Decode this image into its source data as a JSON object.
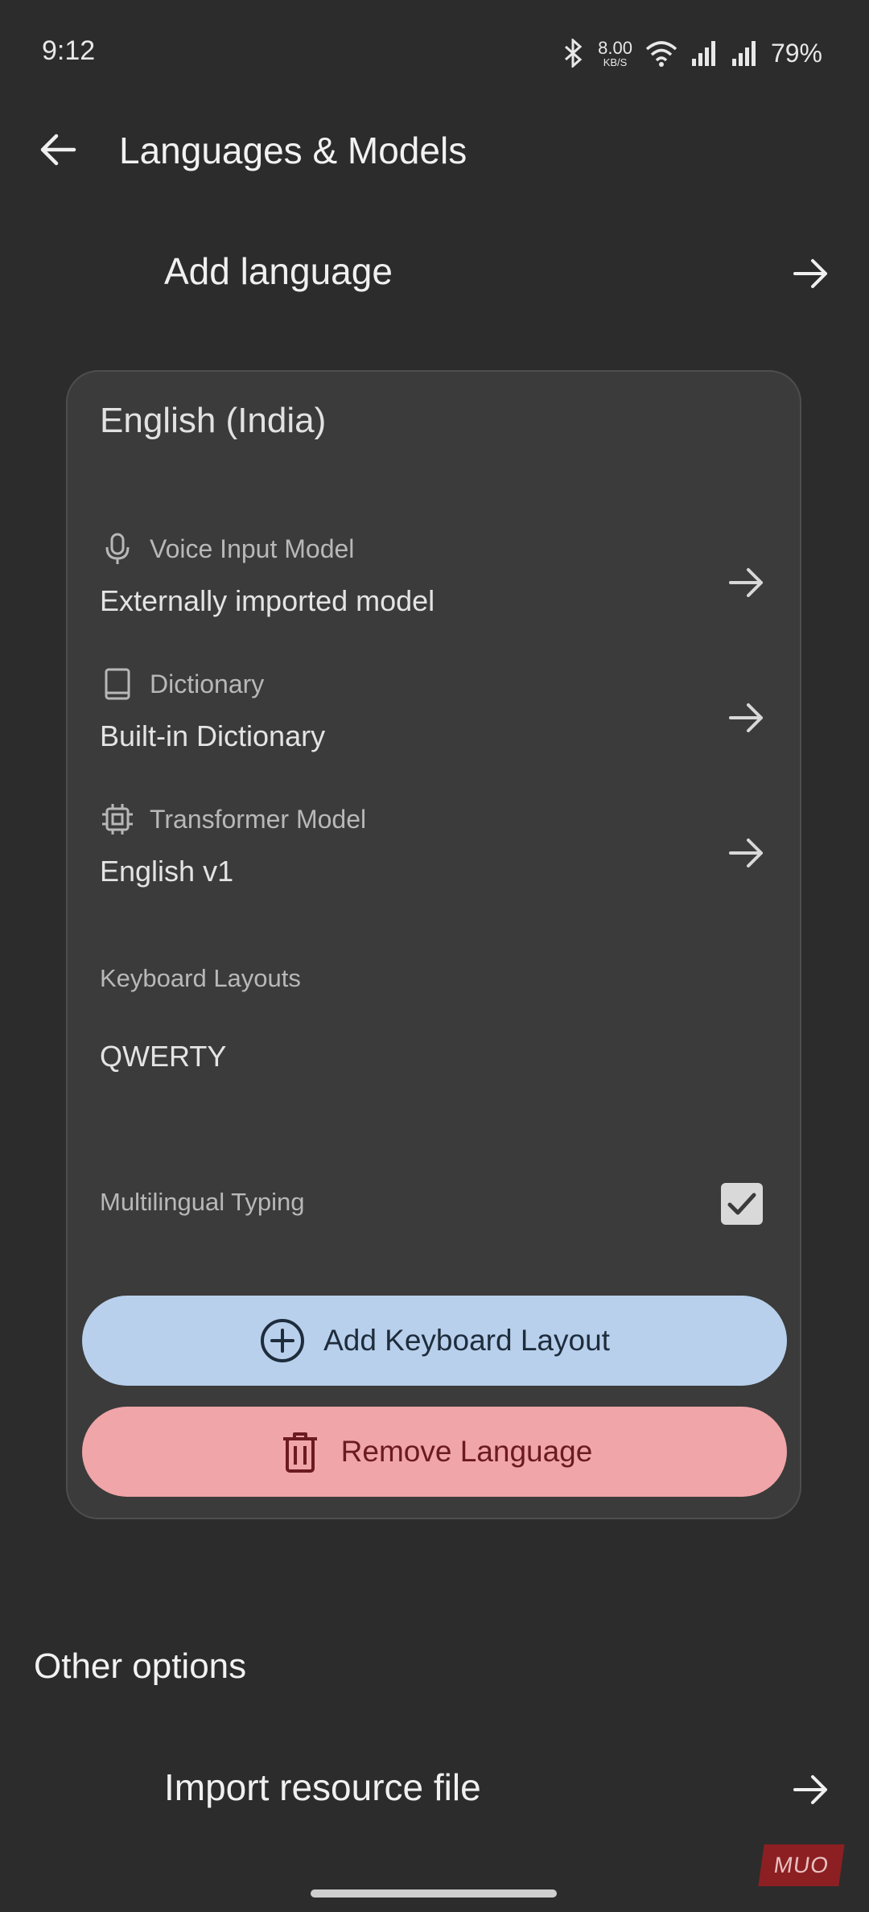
{
  "status_bar": {
    "time": "9:12",
    "speed_value": "8.00",
    "speed_unit": "KB/S",
    "battery": "79%"
  },
  "header": {
    "title": "Languages & Models"
  },
  "add_language": {
    "label": "Add language"
  },
  "language_card": {
    "title": "English (India)",
    "voice_input": {
      "label": "Voice Input Model",
      "value": "Externally imported model"
    },
    "dictionary": {
      "label": "Dictionary",
      "value": "Built-in Dictionary"
    },
    "transformer": {
      "label": "Transformer Model",
      "value": "English v1"
    },
    "keyboard_layouts": {
      "label": "Keyboard Layouts",
      "value": "QWERTY"
    },
    "multilingual": {
      "label": "Multilingual Typing",
      "checked": true
    },
    "add_layout_button": "Add Keyboard Layout",
    "remove_button": "Remove Language"
  },
  "other_options": {
    "title": "Other options",
    "import_label": "Import resource file"
  },
  "watermark": "MUO",
  "colors": {
    "background": "#2c2c2c",
    "card": "#3b3b3b",
    "add_button": "#b8d0ec",
    "remove_button": "#f0a5a8"
  }
}
